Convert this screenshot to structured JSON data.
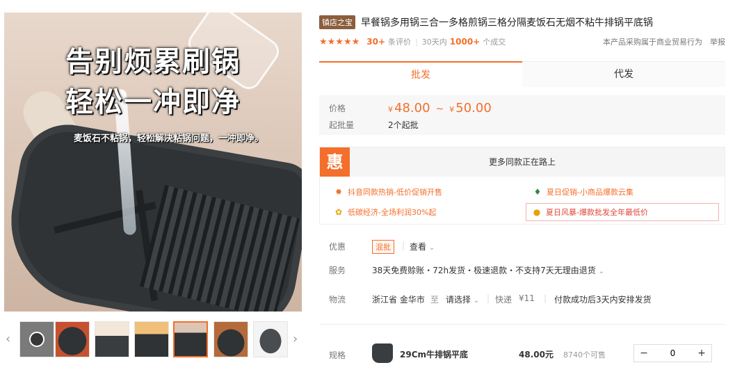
{
  "gallery": {
    "headline_1": "告别烦累刷锅",
    "headline_2": "轻松一冲即净",
    "subline": "麦饭石不粘锅，轻松解决粘锅问题，一冲即净。",
    "prev_arrow": "‹",
    "next_arrow": "›",
    "thumbnails": [
      {
        "name": "video",
        "active": false
      },
      {
        "name": "pan-top",
        "active": false
      },
      {
        "name": "pan-box",
        "active": false
      },
      {
        "name": "pan-grill",
        "active": false
      },
      {
        "name": "pan-main",
        "active": true
      },
      {
        "name": "pan-food",
        "active": false
      },
      {
        "name": "pan-white",
        "active": false
      }
    ]
  },
  "product": {
    "badge": "镇店之宝",
    "title": "早餐锅多用锅三合一多格煎锅三格分隔麦饭石无烟不粘牛排锅平底锅",
    "stars": "★★★★★",
    "review_count": "30+",
    "review_label": "条评价",
    "sales_period": "30天内",
    "sales_count": "1000+",
    "sales_label": "个成交",
    "commercial_note": "本产品采购属于商业贸易行为",
    "report": "举报"
  },
  "tabs": {
    "wholesale": "批发",
    "dropship": "代发"
  },
  "price": {
    "price_label": "价格",
    "currency": "¥",
    "min": "48.00",
    "tilde": "~",
    "max": "50.00",
    "moq_label": "起批量",
    "moq_value": "2个起批"
  },
  "promo": {
    "icon": "惠",
    "header": "更多同款正在路上",
    "items": [
      {
        "text": "抖音同款热销-低价促销开售"
      },
      {
        "text": "夏日促销-小商品爆款云集"
      },
      {
        "text": "低碳经济-全场利润30%起"
      },
      {
        "text": "夏日风暴-爆款批发全年最低价"
      }
    ]
  },
  "info": {
    "discount_label": "优惠",
    "discount_tag": "混批",
    "discount_view": "查看",
    "service_label": "服务",
    "service_value": "38天免费赊账・72h发货・极速退款・不支持7天无理由退货",
    "logistics_label": "物流",
    "origin": "浙江省 金华市",
    "to": "至",
    "destination": "请选择",
    "express": "快递",
    "express_fee": "¥11",
    "ship_note": "付款成功后3天内安排发货"
  },
  "spec": {
    "label": "规格",
    "name": "29Cm牛排锅平底",
    "price": "48.00元",
    "stock": "8740个可售",
    "minus": "−",
    "plus": "+",
    "quantity": "0"
  },
  "colors": {
    "accent": "#f36f2b",
    "badge": "#8b5e3c"
  }
}
